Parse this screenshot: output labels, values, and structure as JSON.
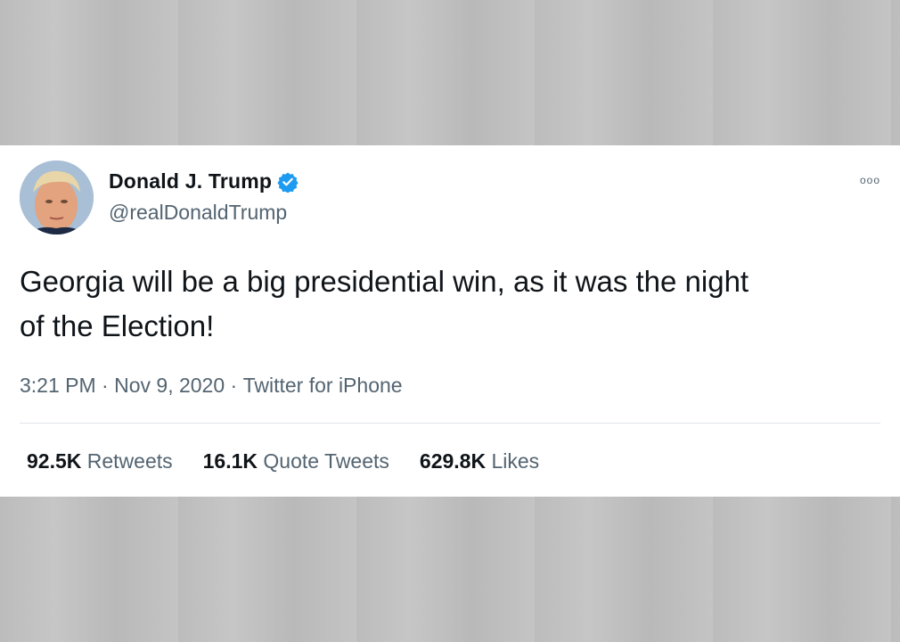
{
  "tweet": {
    "author": {
      "name": "Donald J. Trump",
      "handle": "@realDonaldTrump",
      "verified": true
    },
    "more_icon": "ooo",
    "text_line1": "Georgia will be a big presidential win, as it was the night",
    "text_line2": "of the Election!",
    "time": "3:21 PM",
    "separator": " · ",
    "date": "Nov 9, 2020",
    "source": "Twitter for iPhone",
    "stats": [
      {
        "count": "92.5K",
        "label": "Retweets"
      },
      {
        "count": "16.1K",
        "label": "Quote Tweets"
      },
      {
        "count": "629.8K",
        "label": "Likes"
      }
    ]
  },
  "colors": {
    "verified_blue": "#1d9bf0",
    "text_primary": "#0f1419",
    "text_secondary": "#536471"
  }
}
